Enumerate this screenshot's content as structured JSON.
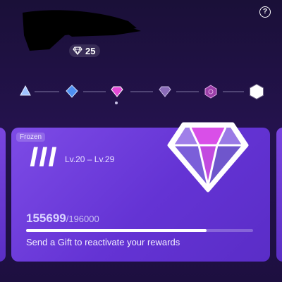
{
  "header": {
    "help_label": "?",
    "gem_count": "25",
    "redacted_name": true
  },
  "tiers": {
    "items": [
      {
        "name": "tier-1-icon",
        "color": "#8fb8ff"
      },
      {
        "name": "tier-2-icon",
        "color": "#5ba0ff"
      },
      {
        "name": "tier-3-icon",
        "color": "#e34fd9"
      },
      {
        "name": "tier-4-icon",
        "color": "#8a6bb8"
      },
      {
        "name": "tier-5-icon",
        "color": "#b64bbf"
      },
      {
        "name": "tier-6-icon",
        "color": "#ffffff"
      }
    ],
    "selected_index": 2
  },
  "card": {
    "status": "Frozen",
    "tier_numeral": "III",
    "level_range": "Lv.20 – Lv.29",
    "progress_current": "155699",
    "progress_total": "/196000",
    "progress_fraction": 0.7944,
    "message": "Send a Gift to reactivate your rewards",
    "accent": "#6a3ad8"
  }
}
